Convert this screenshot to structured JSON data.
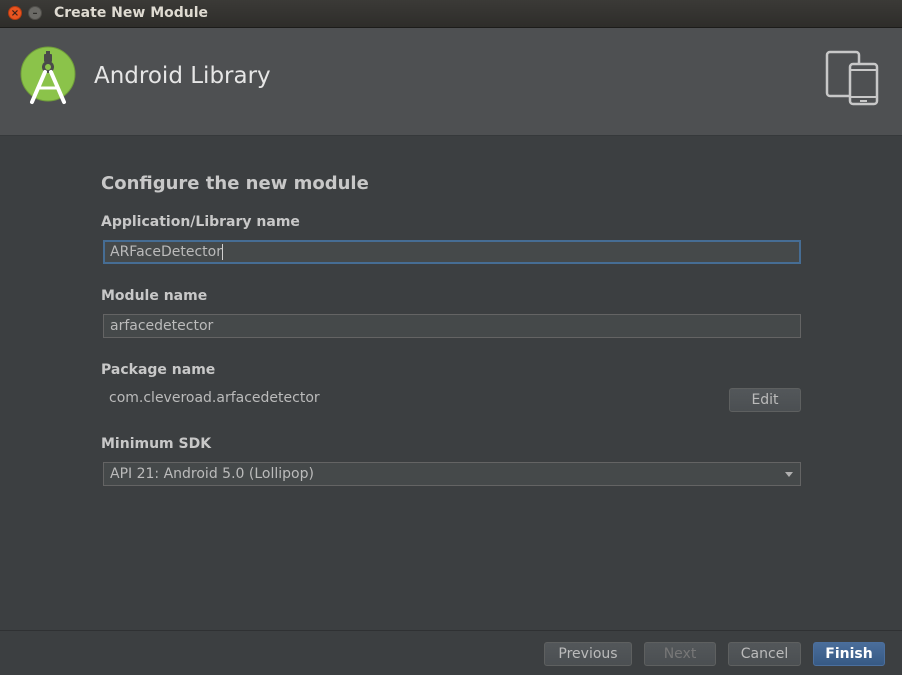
{
  "window": {
    "title": "Create New Module",
    "close_glyph": "×",
    "minimize_glyph": "–"
  },
  "header": {
    "title": "Android Library",
    "logo_icon": "android-studio-logo-icon",
    "device_icon": "tablet-phone-icon"
  },
  "form": {
    "section_title": "Configure the new module",
    "app_name": {
      "label": "Application/Library name",
      "value": "ARFaceDetector"
    },
    "module_name": {
      "label": "Module name",
      "value": "arfacedetector"
    },
    "package_name": {
      "label": "Package name",
      "value": "com.cleveroad.arfacedetector",
      "edit_label": "Edit"
    },
    "min_sdk": {
      "label": "Minimum SDK",
      "value": "API 21: Android 5.0 (Lollipop)"
    }
  },
  "footer": {
    "previous_label": "Previous",
    "next_label": "Next",
    "cancel_label": "Cancel",
    "finish_label": "Finish"
  },
  "colors": {
    "background": "#3c3f41",
    "header": "#4e5052",
    "accent": "#466d94",
    "logo_green": "#8bc34a"
  }
}
